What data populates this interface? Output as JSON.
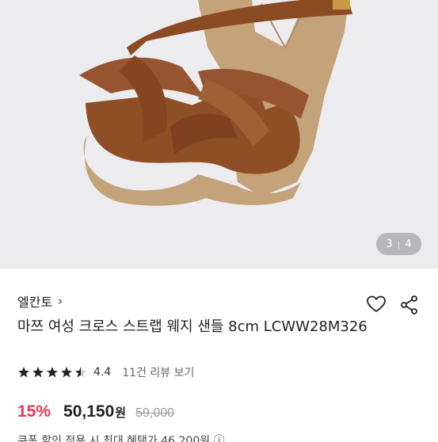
{
  "gallery": {
    "image_alt": "brown cross strap wedge sandal",
    "pager": {
      "current": "3",
      "separator": "|",
      "total": "4"
    }
  },
  "product": {
    "brand": "엘칸토",
    "brand_chevron": "›",
    "title": "마쯔 여성 크로스 스트랩 웨지 샌들 8cm LCWW28M326",
    "rating": {
      "filled_stars": 4.5,
      "max_stars": 5,
      "score": "4.4",
      "review_link": "11건 리뷰 보기"
    },
    "price": {
      "discount": "15%",
      "sale_price": "50,150",
      "currency": "원",
      "original_price": "59,000"
    },
    "partial_line": "쿠폰 할인 적용 시 최대 혜택가 46,200원 ⓘ"
  },
  "colors": {
    "discount": "#e8384f",
    "star": "#222222",
    "star_empty": "#cccccc",
    "leather": "#8a4a22",
    "cork": "#c4a27a"
  },
  "icons": {
    "wishlist": "heart-icon",
    "share": "share-icon",
    "star": "star-icon"
  }
}
